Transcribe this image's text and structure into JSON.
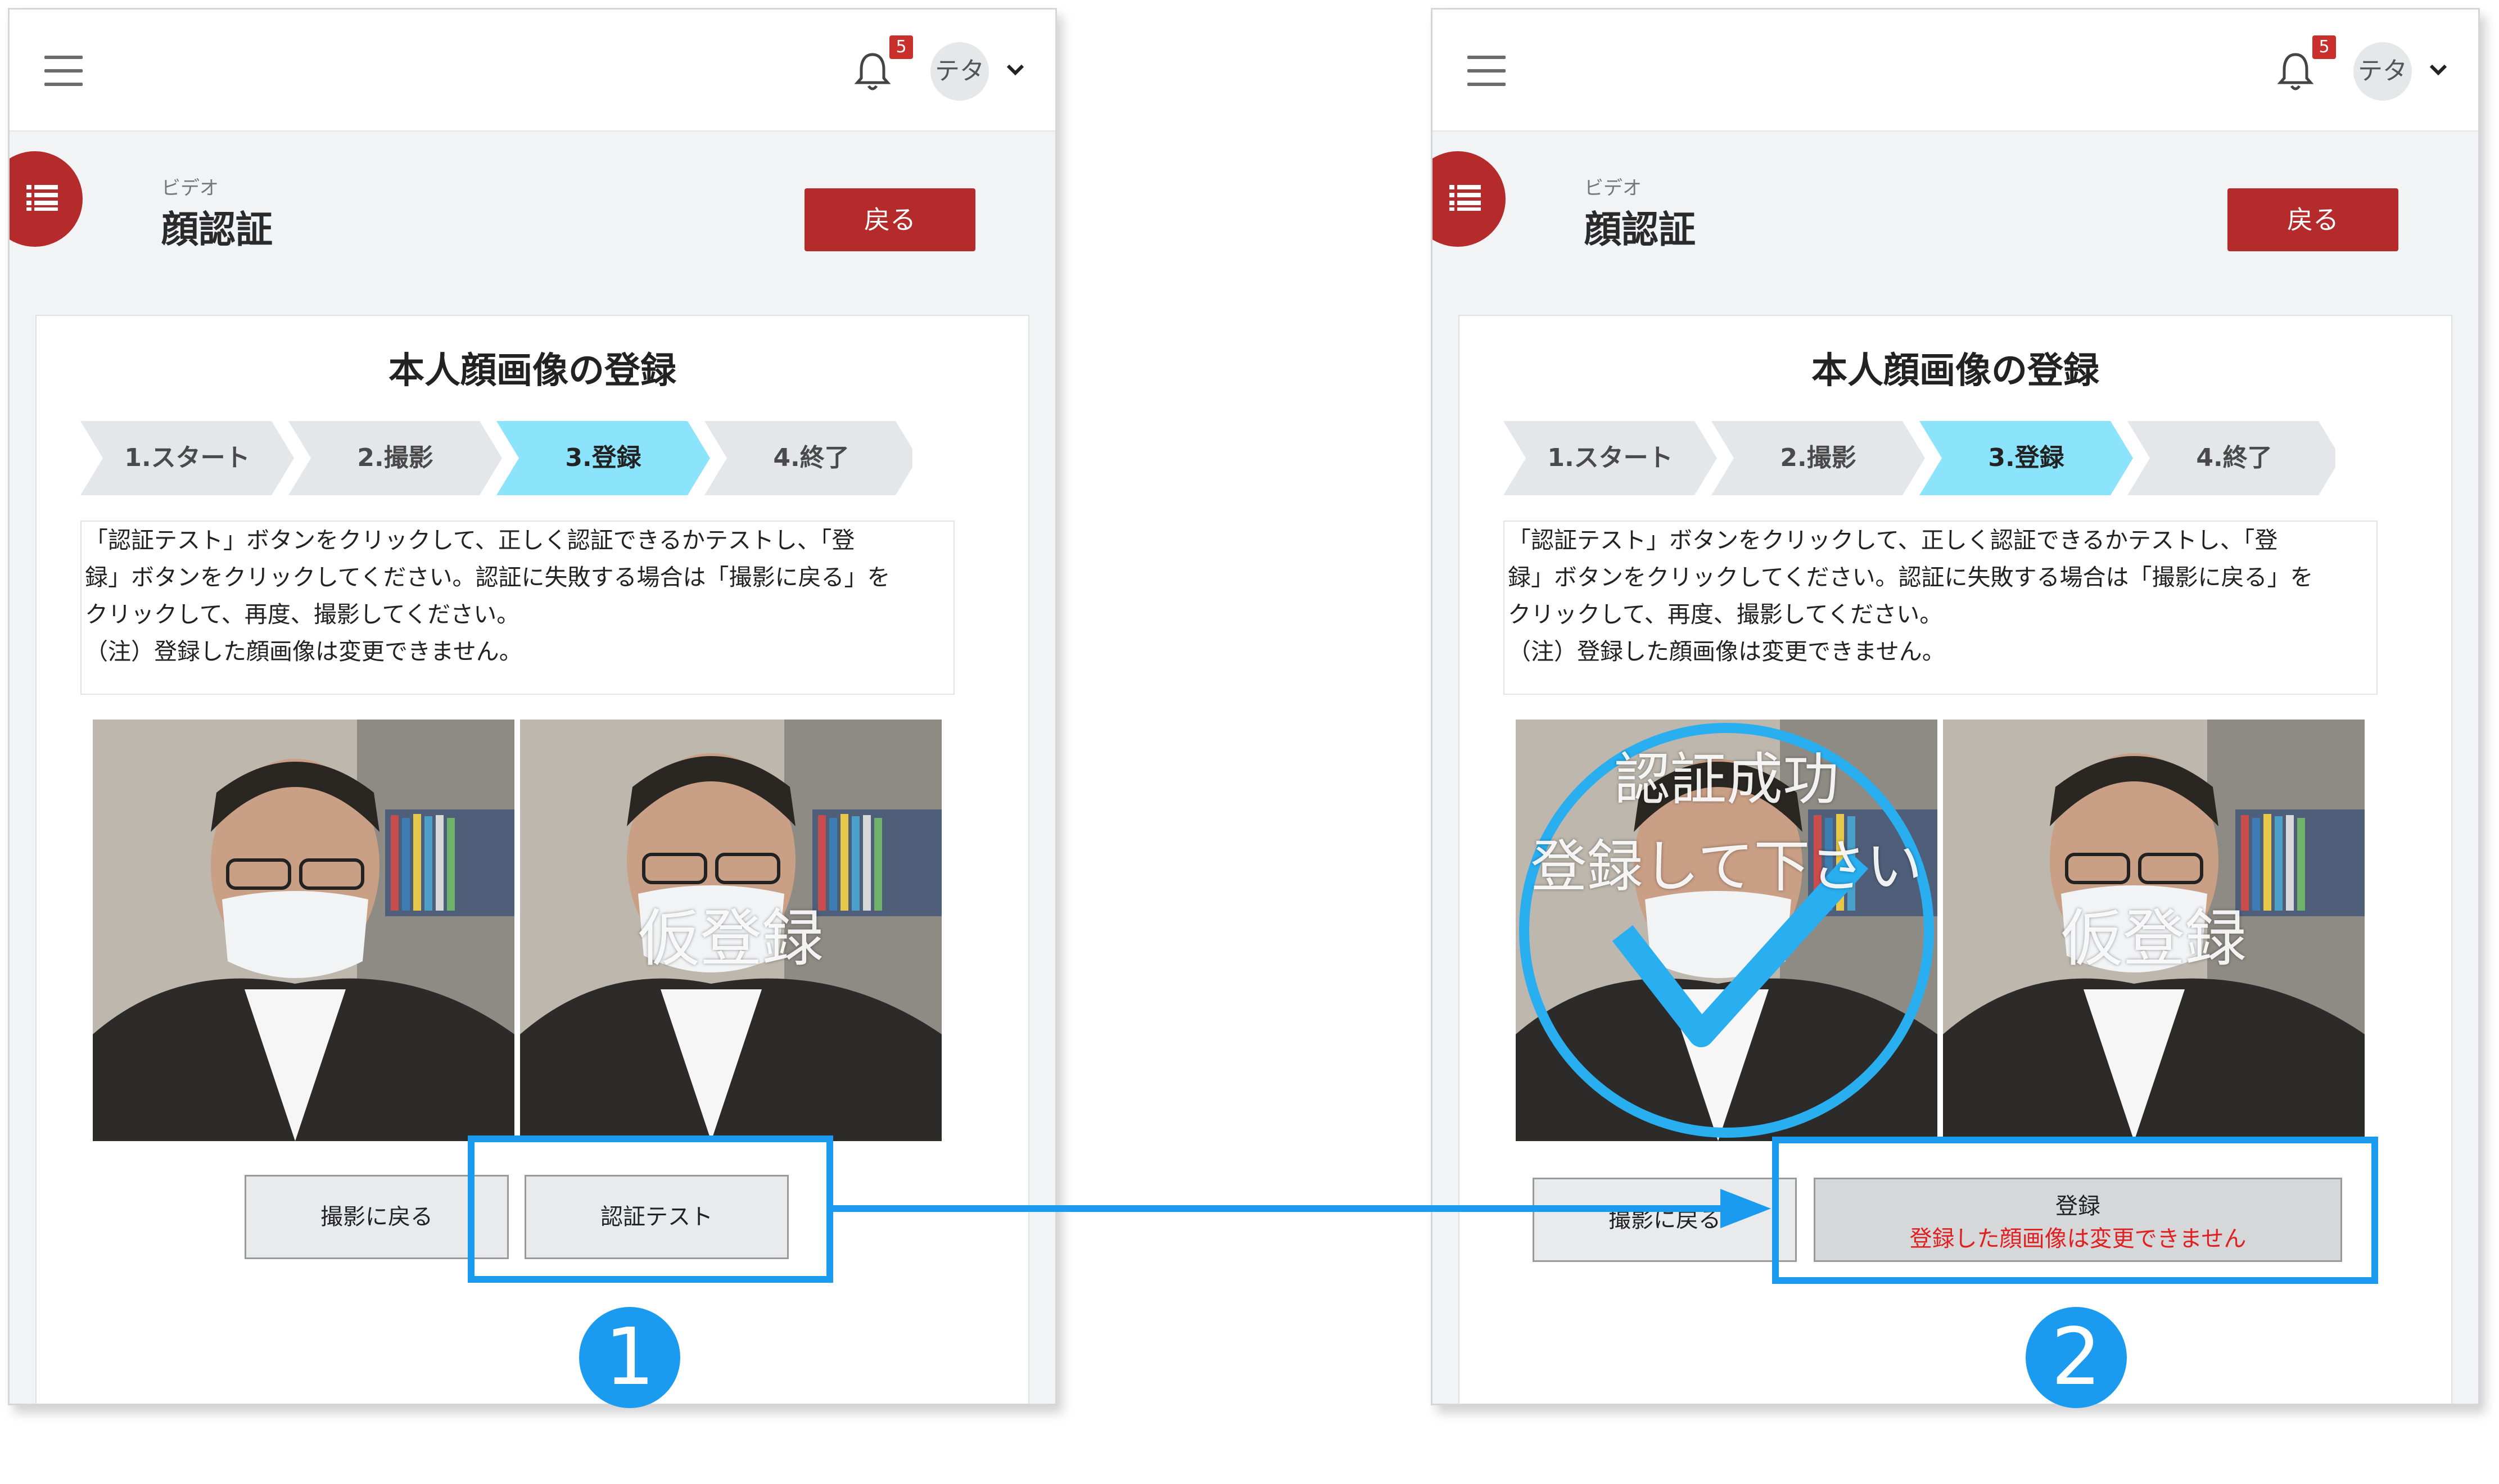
{
  "colors": {
    "accent_red": "#b52a2a",
    "highlight_blue": "#1a9bf0",
    "step_active": "#8be4fb",
    "step_inactive": "#e4e6ea",
    "warning_red": "#e02020"
  },
  "screens": [
    {
      "header": {
        "notification_count": "5",
        "user_initials": "テタ"
      },
      "page": {
        "subtitle": "ビデオ",
        "title": "顔認証",
        "back_label": "戻る"
      },
      "card": {
        "title": "本人顔画像の登録",
        "steps": [
          "1.スタート",
          "2.撮影",
          "3.登録",
          "4.終了"
        ],
        "active_step": 2,
        "instructions": [
          "「認証テスト」ボタンをクリックして、正しく認証できるかテストし、「登",
          "録」ボタンをクリックしてください。認証に失敗する場合は「撮影に戻る」を",
          "クリックして、再度、撮影してください。",
          "（注）登録した顔画像は変更できません。"
        ],
        "photo_right_overlay": "仮登録",
        "back_to_capture_label": "撮影に戻る",
        "auth_test_label": "認証テスト"
      },
      "step_number": "1"
    },
    {
      "header": {
        "notification_count": "5",
        "user_initials": "テタ"
      },
      "page": {
        "subtitle": "ビデオ",
        "title": "顔認証",
        "back_label": "戻る"
      },
      "card": {
        "title": "本人顔画像の登録",
        "steps": [
          "1.スタート",
          "2.撮影",
          "3.登録",
          "4.終了"
        ],
        "active_step": 2,
        "instructions": [
          "「認証テスト」ボタンをクリックして、正しく認証できるかテストし、「登",
          "録」ボタンをクリックしてください。認証に失敗する場合は「撮影に戻る」を",
          "クリックして、再度、撮影してください。",
          "（注）登録した顔画像は変更できません。"
        ],
        "photo_left_overlay_line1": "認証成功",
        "photo_left_overlay_line2": "登録して下さい",
        "photo_right_overlay": "仮登録",
        "back_to_capture_label": "撮影に戻る",
        "register_label": "登録",
        "register_warning": "登録した顔画像は変更できません"
      },
      "step_number": "2"
    }
  ]
}
